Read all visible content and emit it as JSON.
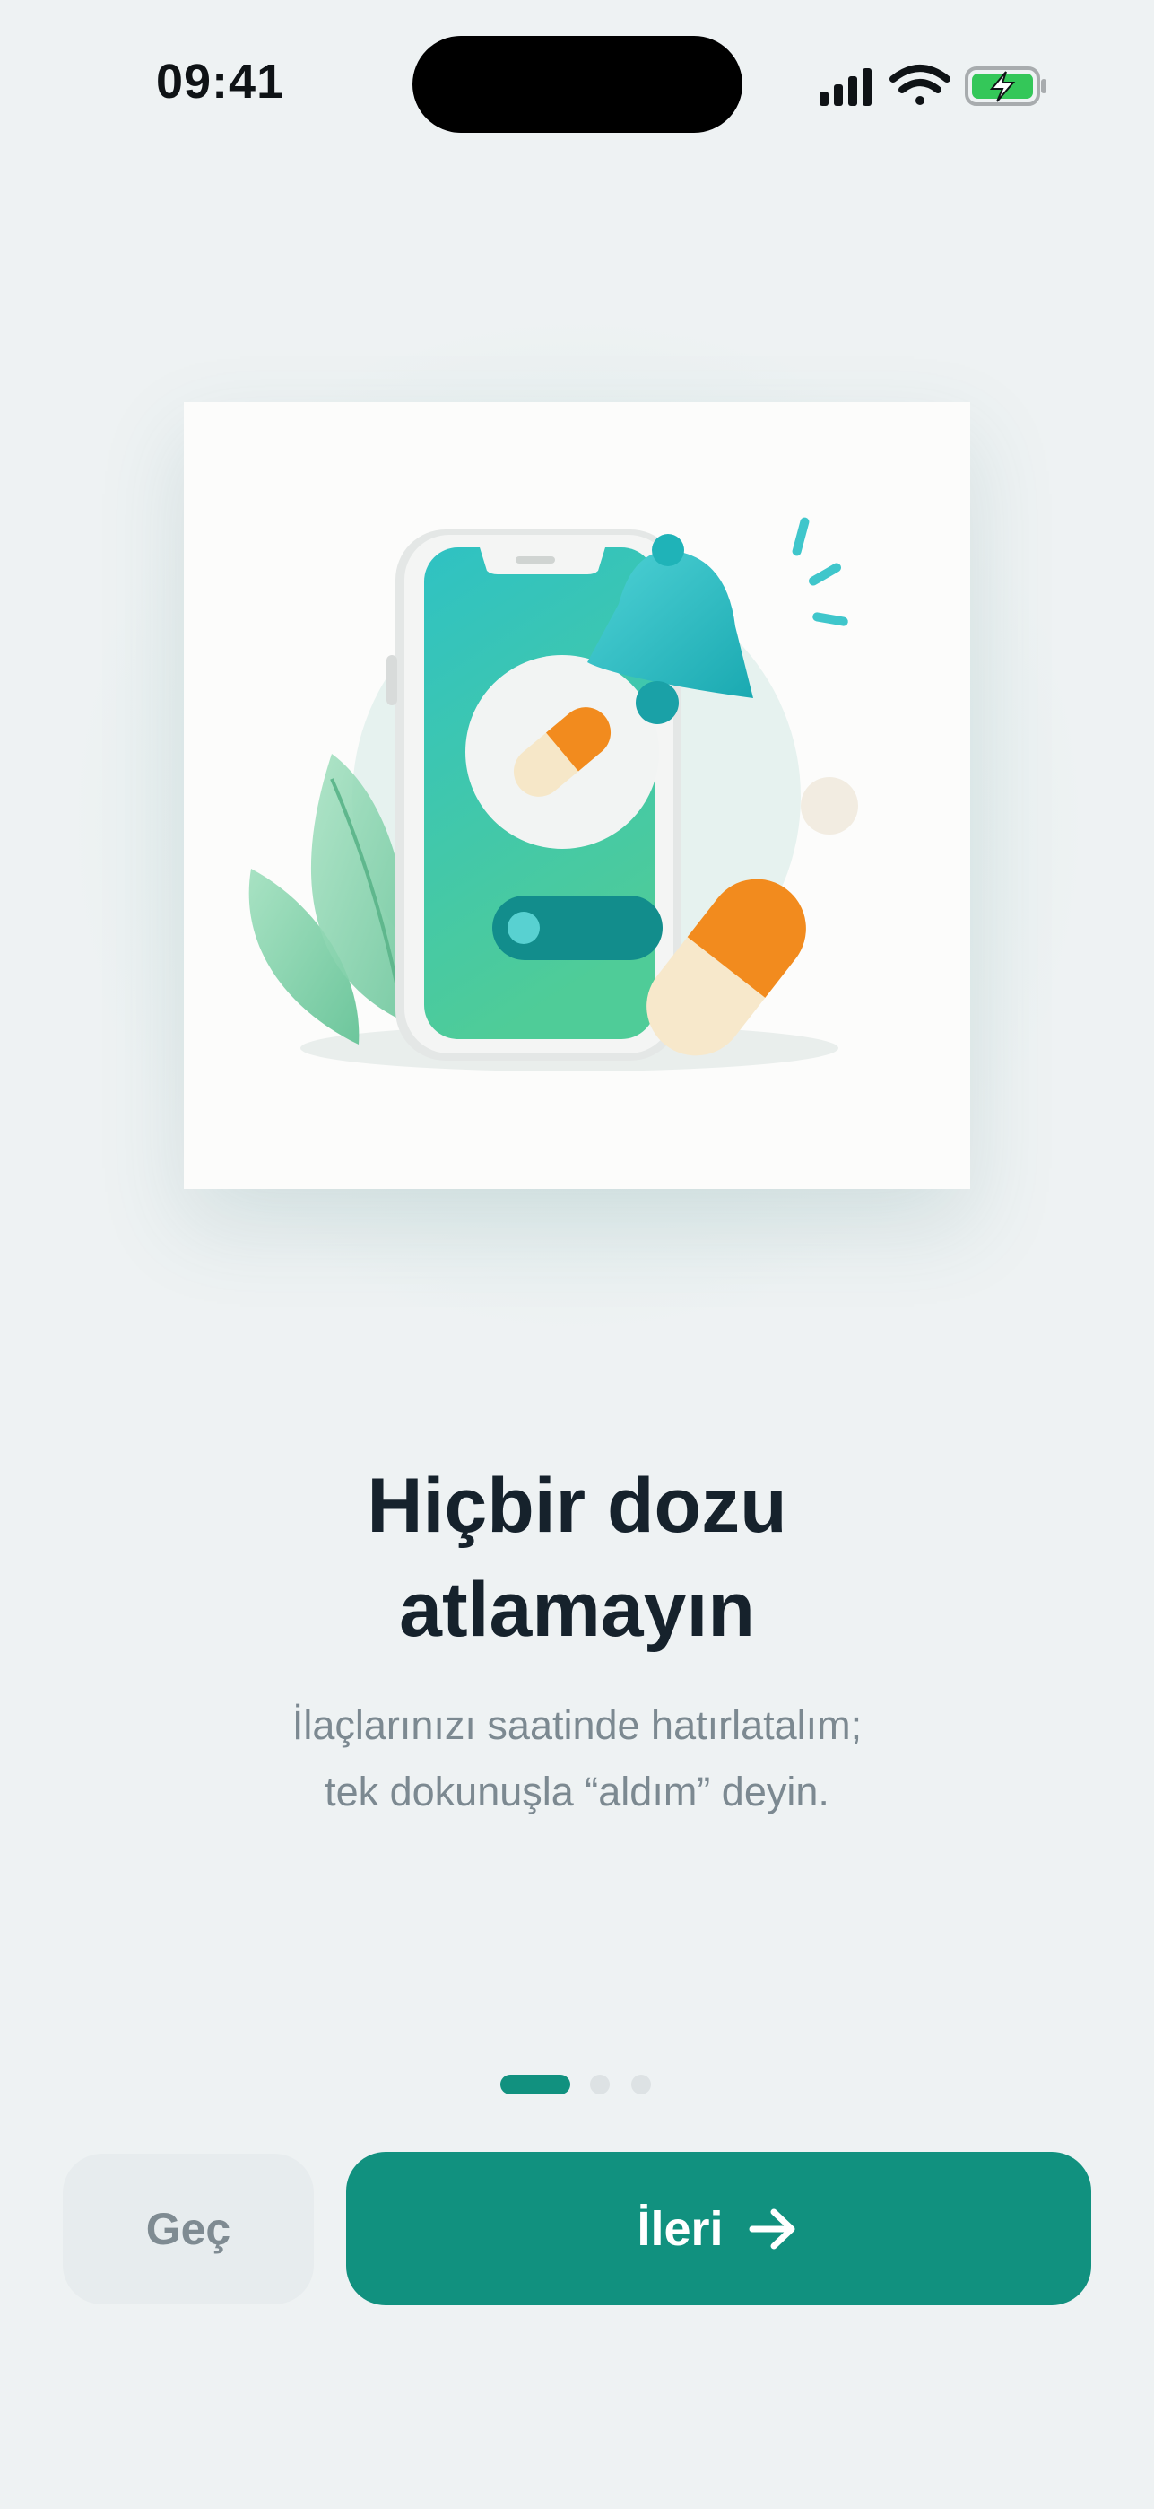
{
  "status_bar": {
    "time": "09:41",
    "icons": [
      "cellular-signal-icon",
      "wifi-icon",
      "battery-charging-icon"
    ]
  },
  "onboarding": {
    "illustration": "phone-pill-reminder-illustration",
    "title_line1": "Hiçbir dozu",
    "title_line2": "atlamayın",
    "subtitle_line1": "İlaçlarınızı saatinde hatırlatalım;",
    "subtitle_line2": "tek dokunuşla “aldım” deyin.",
    "page_count": 3,
    "current_page": 1
  },
  "actions": {
    "skip_label": "Geç",
    "next_label": "İleri",
    "next_icon": "arrow-right-icon"
  },
  "colors": {
    "background": "#eef2f3",
    "primary": "#11917f",
    "title": "#16222c",
    "subtitle": "#7c8991",
    "skip_bg": "#e7ecee"
  }
}
